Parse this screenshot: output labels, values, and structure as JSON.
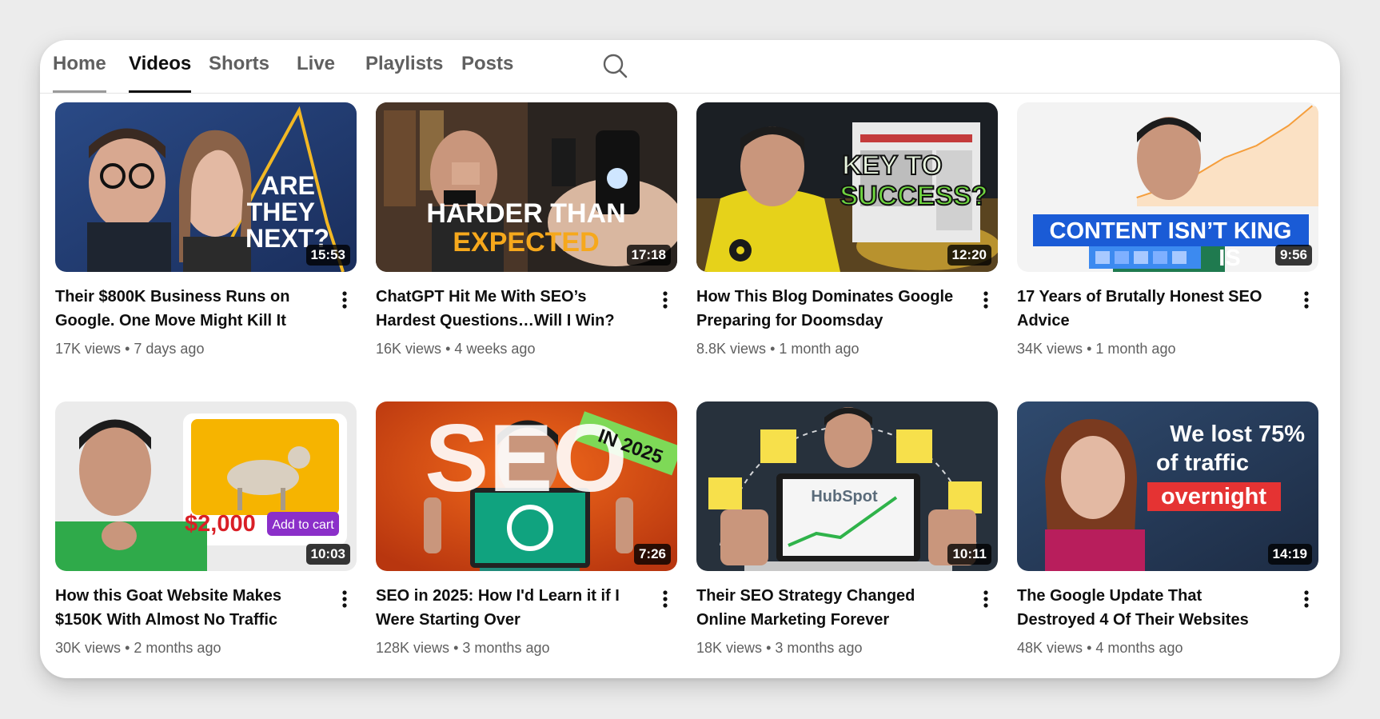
{
  "tabs": [
    {
      "label": "Home",
      "active": false
    },
    {
      "label": "Videos",
      "active": true
    },
    {
      "label": "Shorts",
      "active": false
    },
    {
      "label": "Live",
      "active": false
    },
    {
      "label": "Playlists",
      "active": false
    },
    {
      "label": "Posts",
      "active": false
    }
  ],
  "search": {
    "icon": "search-icon"
  },
  "videos": [
    {
      "title": "Their $800K Business Runs on Google. One Move Might Kill It",
      "views": "17K views",
      "age": "7 days ago",
      "duration": "15:53",
      "thumb_text": [
        "ARE",
        "THEY",
        "NEXT?"
      ]
    },
    {
      "title": "ChatGPT Hit Me With SEO’s Hardest Questions…Will I Win?",
      "views": "16K views",
      "age": "4 weeks ago",
      "duration": "17:18",
      "thumb_text": [
        "HARDER THAN",
        "EXPECTED"
      ]
    },
    {
      "title": "How This Blog Dominates Google Preparing for Doomsday",
      "views": "8.8K views",
      "age": "1 month ago",
      "duration": "12:20",
      "thumb_text": [
        "KEY TO",
        "SUCCESS?"
      ]
    },
    {
      "title": "17 Years of Brutally Honest SEO Advice",
      "views": "34K views",
      "age": "1 month ago",
      "duration": "9:56",
      "thumb_text": [
        "CONTENT ISN’T KING",
        "IS"
      ]
    },
    {
      "title": "How this Goat Website Makes $150K With Almost No Traffic",
      "views": "30K views",
      "age": "2 months ago",
      "duration": "10:03",
      "thumb_text": [
        "$2,000",
        "Add to cart"
      ]
    },
    {
      "title": "SEO in 2025: How I'd Learn it if I Were Starting Over",
      "views": "128K views",
      "age": "3 months ago",
      "duration": "7:26",
      "thumb_text": [
        "SEO",
        "IN 2025"
      ]
    },
    {
      "title": "Their SEO Strategy Changed Online Marketing Forever",
      "views": "18K views",
      "age": "3 months ago",
      "duration": "10:11",
      "thumb_text": [
        "HubSpot"
      ]
    },
    {
      "title": "The Google Update That Destroyed 4 Of Their Websites",
      "views": "48K views",
      "age": "4 months ago",
      "duration": "14:19",
      "thumb_text": [
        "We lost 75%",
        "of traffic",
        "overnight"
      ]
    }
  ],
  "meta_separator": "•",
  "colors": {
    "accent_active": "#0f0f0f",
    "tab_inactive": "#606060",
    "meta": "#606060"
  }
}
